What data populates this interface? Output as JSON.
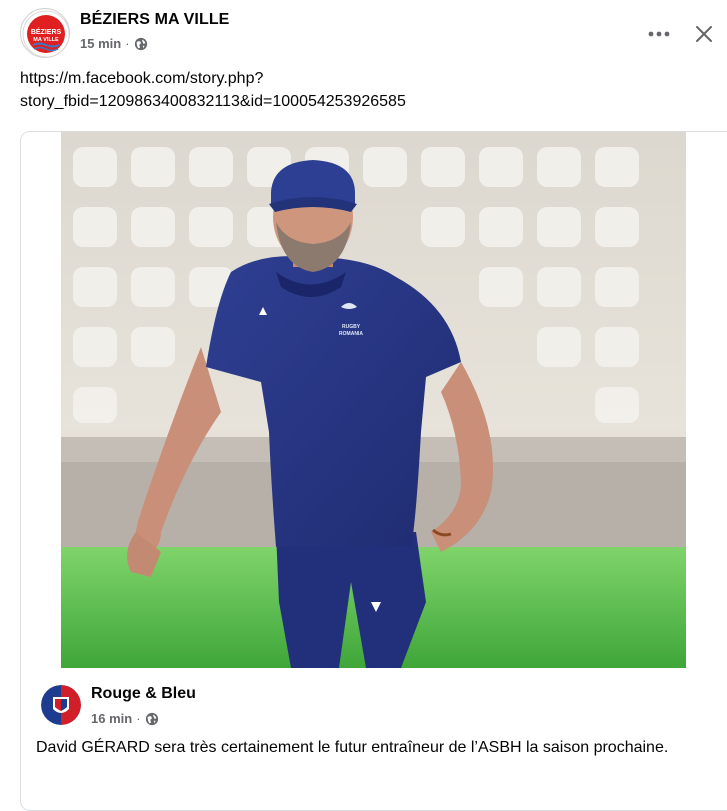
{
  "post": {
    "author": "BÉZIERS MA VILLE",
    "time": "15 min",
    "separator": "·",
    "privacy_icon": "globe-icon",
    "avatar_label_top": "BÉZIERS",
    "avatar_label_bottom": "MA VILLE",
    "url_line1": "https://m.facebook.com/story.php?",
    "url_line2": "story_fbid=1209863400832113&id=100054253926585"
  },
  "header_actions": {
    "more_icon": "more-horizontal-icon",
    "close_icon": "close-icon"
  },
  "photo": {
    "shirt_logo_line1": "RUGBY",
    "shirt_logo_line2": "ROMANIA"
  },
  "shared": {
    "author": "Rouge & Bleu",
    "time": "16 min",
    "separator": "·",
    "privacy_icon": "globe-icon",
    "text": "David GÉRARD sera très certainement le futur entraîneur de l’ASBH la saison prochaine."
  },
  "colors": {
    "text_primary": "#050505",
    "text_secondary": "#65676b",
    "card_border": "#dadde1",
    "brand_red": "#e02020",
    "brand_blue": "#1d3b8f"
  }
}
